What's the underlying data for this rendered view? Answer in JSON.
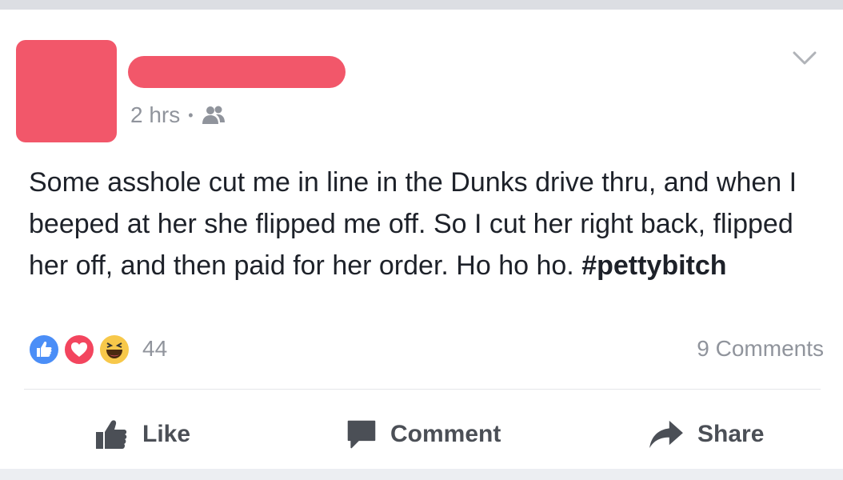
{
  "post": {
    "time": "2 hrs",
    "separator": "•",
    "audience_icon": "friends-icon",
    "text_main": "Some asshole cut me in line in the Dunks drive thru, and when I beeped at her she flipped me off. So I cut her right back, flipped her off, and then paid for her order. Ho ho ho. ",
    "hashtag": "#pettybitch"
  },
  "reactions": {
    "icons": [
      "like-reaction-icon",
      "love-reaction-icon",
      "haha-reaction-icon"
    ],
    "count": "44",
    "comments": "9 Comments"
  },
  "actions": {
    "like": "Like",
    "comment": "Comment",
    "share": "Share"
  },
  "colors": {
    "redaction": "#f2576a",
    "like_blue": "#4b8ef7",
    "love_red": "#f3455e",
    "haha_yellow": "#f7c84a",
    "meta_gray": "#90949c",
    "action_gray": "#4b4f56"
  }
}
